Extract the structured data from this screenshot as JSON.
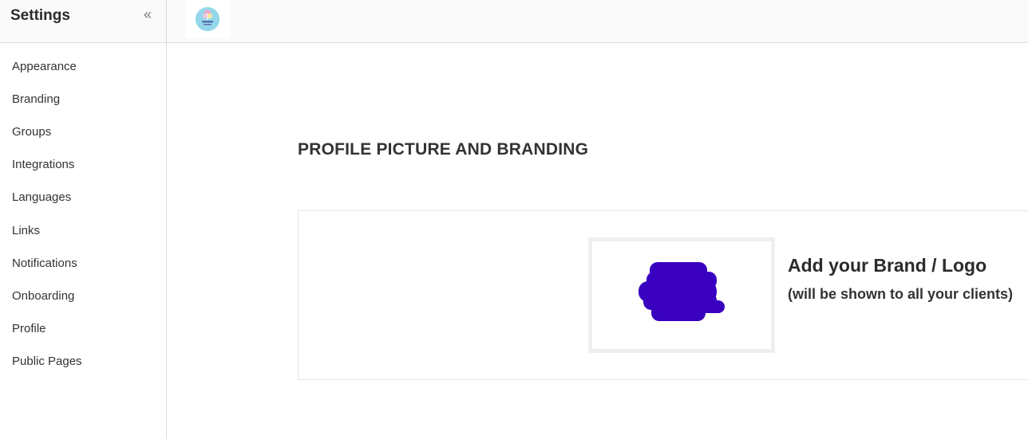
{
  "sidebar": {
    "title": "Settings",
    "collapse_icon": "double-chevron-left-icon",
    "items": [
      {
        "label": "Appearance"
      },
      {
        "label": "Branding"
      },
      {
        "label": "Groups"
      },
      {
        "label": "Integrations"
      },
      {
        "label": "Languages"
      },
      {
        "label": "Links"
      },
      {
        "label": "Notifications"
      },
      {
        "label": "Onboarding"
      },
      {
        "label": "Profile"
      },
      {
        "label": "Public Pages"
      }
    ]
  },
  "topbar": {
    "logo_icon": "brand-logo-icon"
  },
  "main": {
    "section_title": "PROFILE PICTURE AND BRANDING",
    "brand": {
      "heading": "Add your Brand / Logo",
      "subheading": "(will be shown to all your clients)",
      "redaction_color": "#3a00bf"
    }
  }
}
